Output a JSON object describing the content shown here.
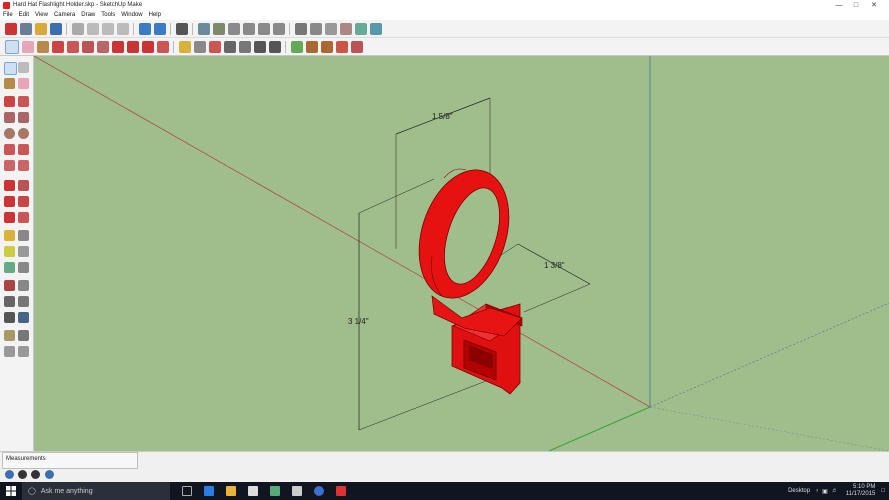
{
  "window": {
    "title": "Hard Hat Flashlight Holder.skp - SketchUp Make",
    "controls": [
      "minimize",
      "maximize",
      "close"
    ]
  },
  "menu": [
    "File",
    "Edit",
    "View",
    "Camera",
    "Draw",
    "Tools",
    "Window",
    "Help"
  ],
  "dimensions": {
    "width": "1 5/8\"",
    "depth": "1 3/8\"",
    "height": "3 1/4\""
  },
  "status": {
    "measurements_label": "Measurements"
  },
  "taskbar": {
    "search_placeholder": "Ask me anything",
    "desktop_label": "Desktop",
    "time": "5:10 PM",
    "date": "11/17/2015"
  },
  "colors": {
    "viewport_bg": "#9fbe8c",
    "model": "#ee1111",
    "red_axis": "#b4474a",
    "blue_axis": "#4f6f8f",
    "green_axis": "#2fa63a"
  }
}
